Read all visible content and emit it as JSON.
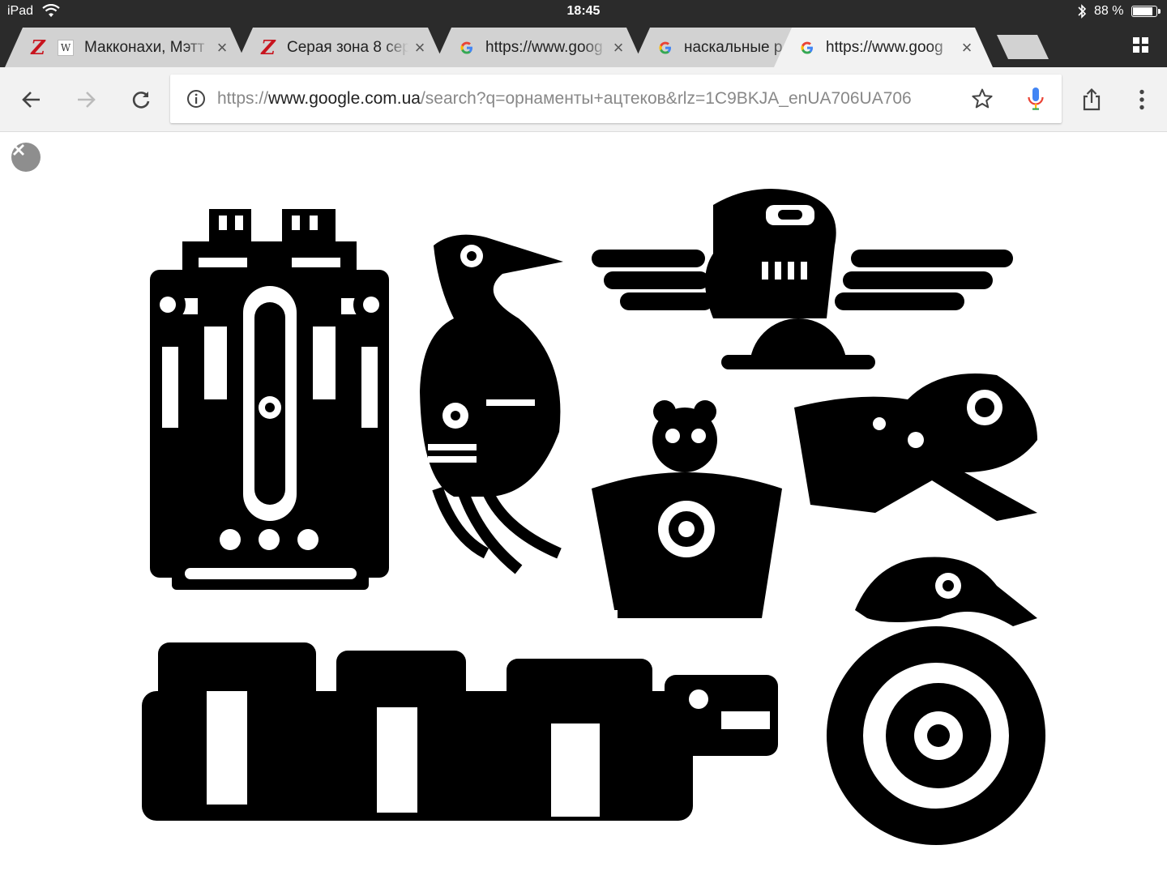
{
  "status_bar": {
    "device": "iPad",
    "time": "18:45",
    "battery": "88 %",
    "battery_level": 0.88
  },
  "tabs": [
    {
      "title": "Макконахи, Мэтт",
      "favicon": "z-icon",
      "favicon2": "wikipedia-icon",
      "active": false
    },
    {
      "title": "Серая зона 8 сер",
      "favicon": "z-icon",
      "active": false
    },
    {
      "title": "https://www.goog",
      "favicon": "google-icon",
      "active": false
    },
    {
      "title": "наскальные р",
      "favicon": "google-icon",
      "active": false
    },
    {
      "title": "https://www.goog",
      "favicon": "google-icon",
      "active": true
    }
  ],
  "omnibox": {
    "scheme": "https://",
    "host": "www.google.com.ua",
    "path": "/search?q=орнаменты+ацтеков&rlz=1C9BKJA_enUA706UA706"
  },
  "icons": {
    "back": "arrow-left-icon",
    "forward": "arrow-right-icon",
    "reload": "reload-icon",
    "info": "info-icon",
    "bookmark": "star-icon",
    "voice": "microphone-icon",
    "share": "share-icon",
    "menu": "more-vert-icon",
    "close": "close-icon",
    "tab_switcher": "tab-grid-icon"
  },
  "colors": {
    "chrome_dark": "#2b2b2b",
    "tab_inactive": "#d2d2d2",
    "tab_active": "#f2f2f2",
    "toolbar": "#f2f2f2",
    "ink": "#000000"
  }
}
